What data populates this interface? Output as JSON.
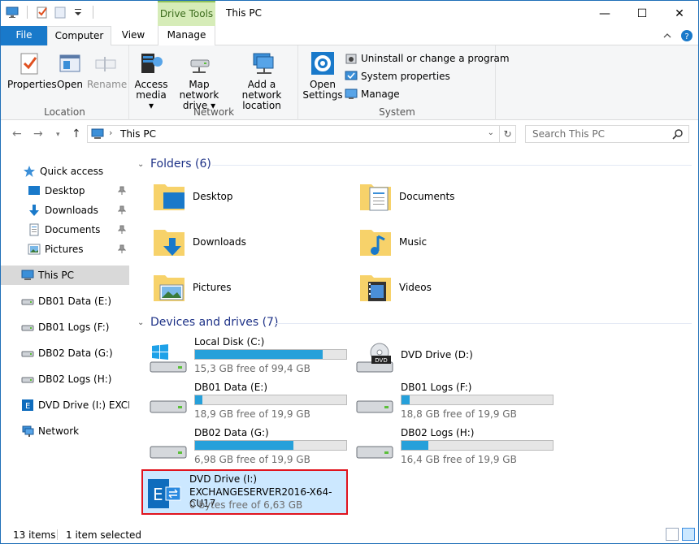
{
  "window": {
    "title": "This PC",
    "contextual_tab": "Drive Tools",
    "controls": {
      "minimize": "—",
      "maximize": "☐",
      "close": "✕"
    }
  },
  "tabs": {
    "file": "File",
    "computer": "Computer",
    "view": "View",
    "manage": "Manage"
  },
  "ribbon": {
    "location": {
      "label": "Location",
      "properties": "Properties",
      "open": "Open",
      "rename": "Rename"
    },
    "network": {
      "label": "Network",
      "access_media_1": "Access",
      "access_media_2": "media ▾",
      "map_drive_1": "Map network",
      "map_drive_2": "drive ▾",
      "add_location_1": "Add a network",
      "add_location_2": "location"
    },
    "system": {
      "label": "System",
      "open_settings_1": "Open",
      "open_settings_2": "Settings",
      "uninstall": "Uninstall or change a program",
      "system_properties": "System properties",
      "manage": "Manage"
    }
  },
  "address": {
    "path": "This PC",
    "search_placeholder": "Search This PC"
  },
  "nav": {
    "quick_access": "Quick access",
    "desktop": "Desktop",
    "downloads": "Downloads",
    "documents": "Documents",
    "pictures": "Pictures",
    "this_pc": "This PC",
    "db01_data": "DB01 Data (E:)",
    "db01_logs": "DB01 Logs (F:)",
    "db02_data": "DB02 Data (G:)",
    "db02_logs": "DB02 Logs (H:)",
    "dvd": "DVD Drive (I:) EXCHA",
    "network": "Network"
  },
  "folders": {
    "header": "Folders (6)",
    "items": {
      "desktop": "Desktop",
      "documents": "Documents",
      "downloads": "Downloads",
      "music": "Music",
      "pictures": "Pictures",
      "videos": "Videos"
    }
  },
  "drives": {
    "header": "Devices and drives (7)",
    "c": {
      "name": "Local Disk (C:)",
      "free": "15,3 GB free of 99,4 GB",
      "used_fraction": 0.846
    },
    "d": {
      "name": "DVD Drive (D:)"
    },
    "e": {
      "name": "DB01 Data (E:)",
      "free": "18,9 GB free of 19,9 GB",
      "used_fraction": 0.05
    },
    "f": {
      "name": "DB01 Logs (F:)",
      "free": "18,8 GB free of 19,9 GB",
      "used_fraction": 0.055
    },
    "g": {
      "name": "DB02 Data (G:)",
      "free": "6,98 GB free of 19,9 GB",
      "used_fraction": 0.65
    },
    "h": {
      "name": "DB02 Logs (H:)",
      "free": "16,4 GB free of 19,9 GB",
      "used_fraction": 0.176
    },
    "i": {
      "name": "DVD Drive (I:)",
      "label": "EXCHANGESERVER2016-X64-CU17",
      "free": "0 bytes free of 6,63 GB"
    }
  },
  "status": {
    "count": "13 items",
    "selected": "1 item selected"
  },
  "colors": {
    "accent": "#1979ca",
    "bar_fill": "#26a0da",
    "selection": "#cce8ff",
    "highlight_border": "#e0141e",
    "group_header": "#1e3287"
  }
}
